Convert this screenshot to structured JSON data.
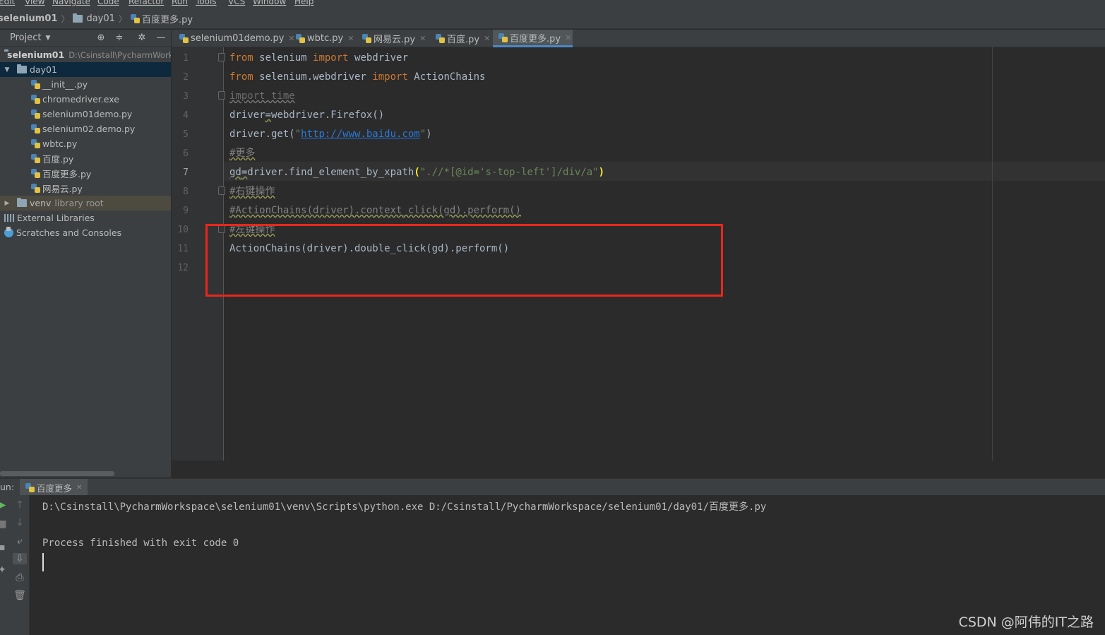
{
  "menu": [
    "Edit",
    "View",
    "Navigate",
    "Code",
    "Refactor",
    "Run",
    "Tools",
    "VCS",
    "Window",
    "Help"
  ],
  "breadcrumb": {
    "project": "selenium01",
    "folder": "day01",
    "file": "百度更多.py"
  },
  "project_panel": {
    "title": "Project",
    "root_name": "selenium01",
    "root_path": "D:\\Csinstall\\PycharmWorkspace",
    "folder": "day01",
    "files": [
      "__init__.py",
      "chromedriver.exe",
      "selenium01demo.py",
      "selenium02.demo.py",
      "wbtc.py",
      "百度.py",
      "百度更多.py",
      "网易云.py"
    ],
    "venv": "venv",
    "venv_note": "library root",
    "external": "External Libraries",
    "scratches": "Scratches and Consoles"
  },
  "tabs": [
    {
      "label": "selenium01demo.py",
      "active": false
    },
    {
      "label": "wbtc.py",
      "active": false
    },
    {
      "label": "网易云.py",
      "active": false
    },
    {
      "label": "百度.py",
      "active": false
    },
    {
      "label": "百度更多.py",
      "active": true
    }
  ],
  "line_numbers": [
    "1",
    "2",
    "3",
    "4",
    "5",
    "6",
    "7",
    "8",
    "9",
    "10",
    "11",
    "12"
  ],
  "code": {
    "l1": {
      "kw1": "from",
      "t1": " selenium ",
      "kw2": "import",
      "t2": " webdriver"
    },
    "l2": {
      "kw1": "from",
      "t1": " selenium.webdriver ",
      "kw2": "import",
      "t2": " ActionChains"
    },
    "l3": "import time",
    "l4": {
      "a": "driver",
      "b": "=",
      "c": "webdriver.Firefox()"
    },
    "l5": {
      "a": "driver.get(",
      "q1": "\"",
      "url": "http://www.baidu.com",
      "q2": "\"",
      "b": ")"
    },
    "l6": "#更多",
    "l7": {
      "a": "gd",
      "b": "=",
      "c": "driver.find_element_by_xpath",
      "p1": "(",
      "s": "\".//*[@id='s-top-left']/div/a\"",
      "p2": ")"
    },
    "l8": "#右键操作",
    "l9": "#ActionChains(driver).context_click(gd).perform()",
    "l10": "#左键操作",
    "l11": "ActionChains(driver).double_click(gd).perform()"
  },
  "run": {
    "label": "un:",
    "tab": "百度更多",
    "command": "D:\\Csinstall\\PycharmWorkspace\\selenium01\\venv\\Scripts\\python.exe D:/Csinstall/PycharmWorkspace/selenium01/day01/百度更多.py",
    "result": "Process finished with exit code 0"
  },
  "watermark": "CSDN @阿伟的IT之路",
  "colors": {
    "highlight_box": "#e8271c",
    "keyword": "#cc7832",
    "string": "#6a8759",
    "comment": "#808080"
  }
}
